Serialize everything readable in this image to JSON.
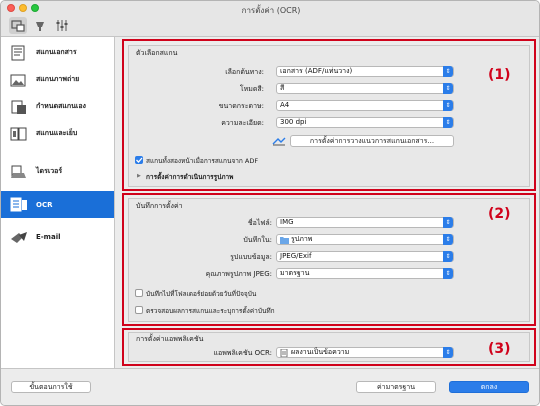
{
  "window": {
    "title": "การตั้งค่า (OCR)"
  },
  "sidebar": {
    "items": [
      {
        "label": "สแกนเอกสาร"
      },
      {
        "label": "สแกนภาพถ่าย"
      },
      {
        "label": "กำหนดสแกนเอง"
      },
      {
        "label": "สแกนและเย็บ"
      },
      {
        "label": "ไดรเวอร์"
      },
      {
        "label": "OCR"
      },
      {
        "label": "E-mail"
      }
    ]
  },
  "scan_options": {
    "group_label": "ตัวเลือกสแกน",
    "source_label": "เลือกต้นทาง:",
    "source_value": "เอกสาร (ADF/แท่นวาง)",
    "color_mode_label": "โหมดสี:",
    "color_mode_value": "สี",
    "paper_size_label": "ขนาดกระดาษ:",
    "paper_size_value": "A4",
    "resolution_label": "ความละเอียด:",
    "resolution_value": "300 dpi",
    "document_settings_button": "การตั้งค่าการวางแนวการสแกนเอกสาร...",
    "duplex_checkbox": "สแกนทั้งสองหน้าเมื่อการสแกนจาก ADF",
    "image_processing": "การตั้งค่าการดำเนินการรูปภาพ",
    "badge": "(1)"
  },
  "save_settings": {
    "group_label": "บันทึกการตั้งค่า",
    "filename_label": "ชื่อไฟล์:",
    "filename_value": "IMG",
    "save_in_label": "บันทึกใน:",
    "save_in_value": "รูปภาพ",
    "data_format_label": "รูปแบบข้อมูล:",
    "data_format_value": "JPEG/Exif",
    "jpeg_quality_label": "คุณภาพรูปภาพ JPEG:",
    "jpeg_quality_value": "มาตรฐาน",
    "subfolder_checkbox": "บันทึกไปที่โฟลเดอร์ย่อยด้วยวันที่ปัจจุบัน",
    "check_results_checkbox": "ตรวจสอบผลการสแกนและระบุการตั้งค่าบันทึก",
    "badge": "(2)"
  },
  "app_settings": {
    "group_label": "การตั้งค่าแอพพลิเคชัน",
    "ocr_app_label": "แอพพลิเคชัน OCR:",
    "ocr_app_value": "ผลงานเป็นข้อความ",
    "badge": "(3)"
  },
  "footer": {
    "instructions_button": "ขั้นตอนการใช้",
    "defaults_button": "ค่ามาตรฐาน",
    "ok_button": "ตกลง"
  },
  "colors": {
    "accent": "#2b7de9",
    "selection": "#1a6fd8",
    "highlight": "#d0021b"
  }
}
